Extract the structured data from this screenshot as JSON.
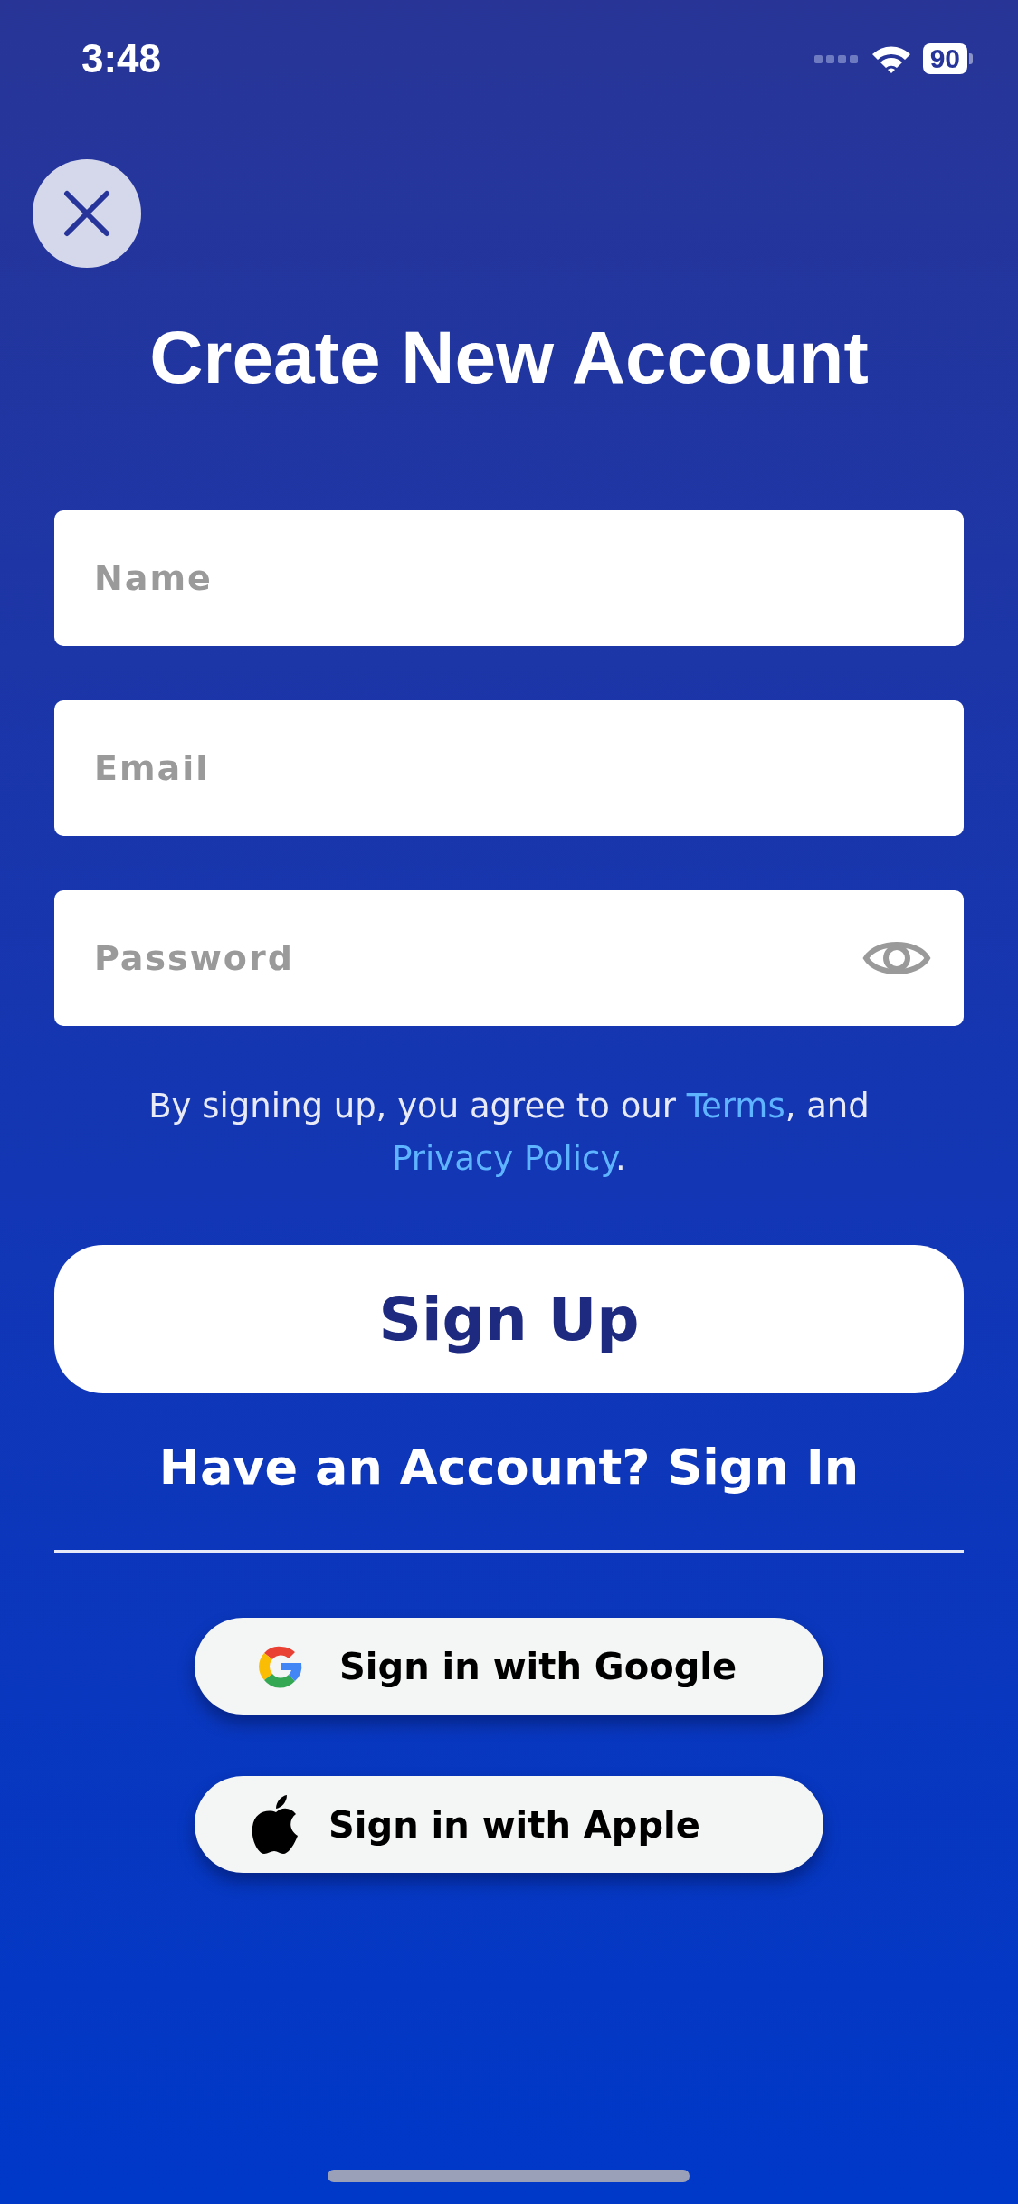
{
  "status_bar": {
    "time": "3:48",
    "battery": "90"
  },
  "title": "Create New Account",
  "fields": [
    {
      "kind": "text",
      "placeholder": "Name"
    },
    {
      "kind": "text",
      "placeholder": "Email"
    },
    {
      "kind": "password",
      "placeholder": "Password"
    }
  ],
  "terms": [
    {
      "kind": "text",
      "text": "By signing up, you agree to our "
    },
    {
      "kind": "link",
      "text": "Terms"
    },
    {
      "kind": "text",
      "text": ", and "
    },
    {
      "kind": "link",
      "text": "Privacy Policy"
    },
    {
      "kind": "text",
      "text": "."
    }
  ],
  "primary_button": "Sign Up",
  "sign_in_link": "Have an Account? Sign In",
  "social_buttons": [
    {
      "kind": "google",
      "label": "Sign in with Google"
    },
    {
      "kind": "apple",
      "label": "Sign in with Apple"
    }
  ]
}
